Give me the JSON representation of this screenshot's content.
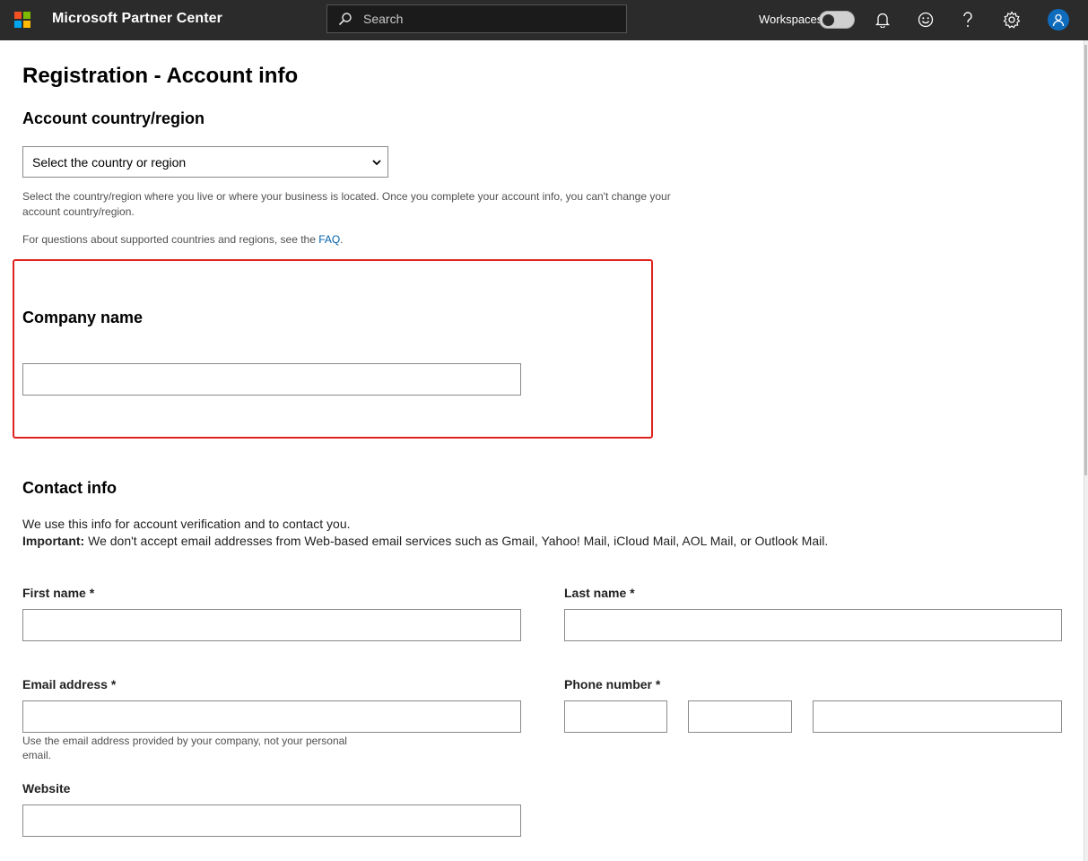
{
  "header": {
    "app_title": "Microsoft Partner Center",
    "search_placeholder": "Search",
    "workspaces_label": "Workspaces",
    "icons": [
      "microsoft-logo-icon",
      "search-icon",
      "bell-icon",
      "smiley-icon",
      "help-icon",
      "gear-icon",
      "user-avatar-icon"
    ],
    "logo_colors": [
      "#f25022",
      "#7fba00",
      "#00a4ef",
      "#ffb900"
    ]
  },
  "page": {
    "title": "Registration - Account info"
  },
  "country": {
    "heading": "Account country/region",
    "select_value": "Select the country or region",
    "help_line1": "Select the country/region where you live or where your business is located. Once you complete your account info, you can't change your",
    "help_line2": "account country/region.",
    "faq_prefix": "For questions about supported countries and regions, see the ",
    "faq_link": "FAQ",
    "faq_suffix": "."
  },
  "company": {
    "heading": "Company name",
    "value": ""
  },
  "contact": {
    "heading": "Contact info",
    "intro": "We use this info for account verification and to contact you.",
    "important_label": "Important:",
    "important_text": " We don't accept email addresses from Web-based email services such as Gmail, Yahoo! Mail, iCloud Mail, AOL Mail, or Outlook Mail.",
    "first_name_label": "First name *",
    "last_name_label": "Last name *",
    "email_label": "Email address *",
    "email_help_line1": "Use the email address provided by your company, not your personal",
    "email_help_line2": "email.",
    "phone_label": "Phone number *",
    "website_label": "Website"
  },
  "colors": {
    "topbar": "#2b2b2b",
    "highlight": "#e0221f",
    "link": "#0062ad",
    "avatar": "#0f6cbd"
  }
}
